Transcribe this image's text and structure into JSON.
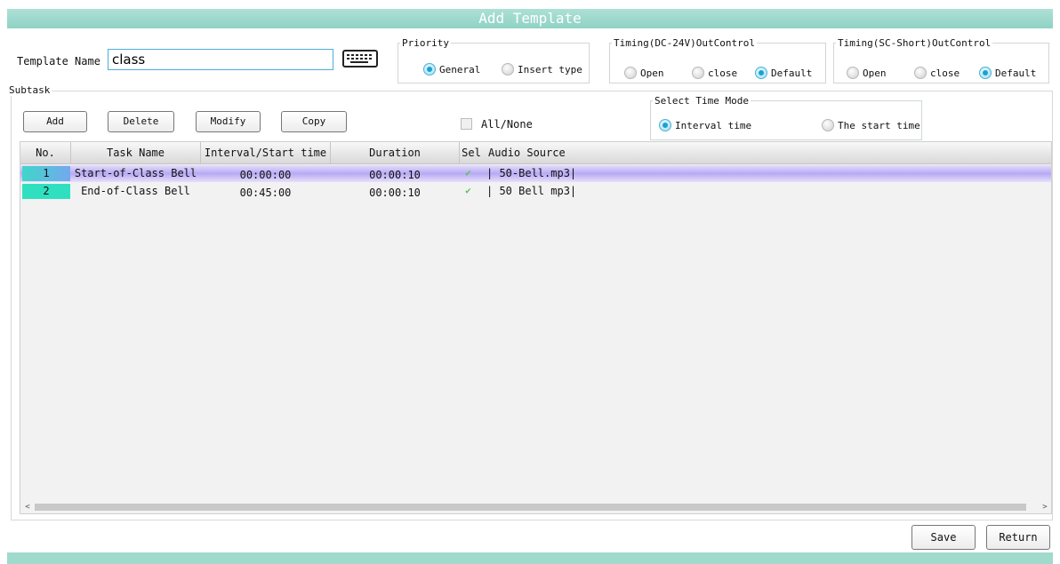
{
  "window": {
    "title": "Add Template"
  },
  "template_name": {
    "label": "Template Name :",
    "value": "class"
  },
  "icons": {
    "keyboard": "keyboard-icon",
    "check": "checkmark-icon",
    "scroll_left": "chevron-left-icon",
    "scroll_right": "chevron-right-icon"
  },
  "priority": {
    "title": "Priority",
    "options": [
      "General",
      "Insert type"
    ],
    "selected": "General"
  },
  "timing_dc": {
    "title": "Timing(DC-24V)OutControl",
    "options": [
      "Open",
      "close",
      "Default"
    ],
    "selected": "Default"
  },
  "timing_sc": {
    "title": "Timing(SC-Short)OutControl",
    "options": [
      "Open",
      "close",
      "Default"
    ],
    "selected": "Default"
  },
  "subtask": {
    "label": "Subtask",
    "buttons": {
      "add": "Add",
      "delete": "Delete",
      "modify": "Modify",
      "copy": "Copy"
    },
    "all_none": "All/None",
    "time_mode": {
      "title": "Select Time Mode",
      "options": [
        "Interval time",
        "The start time"
      ],
      "selected": "Interval time"
    }
  },
  "table": {
    "columns": [
      "No.",
      "Task Name",
      "Interval/Start time",
      "Duration",
      "Sel",
      "Audio Source"
    ],
    "rows": [
      {
        "no": "1",
        "task_name": "Start-of-Class Bell",
        "time": "00:00:00",
        "duration": "00:00:10",
        "sel": true,
        "audio": "| 50-Bell.mp3|"
      },
      {
        "no": "2",
        "task_name": "End-of-Class Bell",
        "time": "00:45:00",
        "duration": "00:00:10",
        "sel": true,
        "audio": "| 50 Bell mp3|"
      }
    ],
    "selected_row": 0
  },
  "footer": {
    "save": "Save",
    "return": "Return"
  },
  "colors": {
    "title_bar": "#9fdacd",
    "accent": "#16a2d4",
    "row_number": "#2fe0c0",
    "selected_row": "#b7aaf4"
  }
}
